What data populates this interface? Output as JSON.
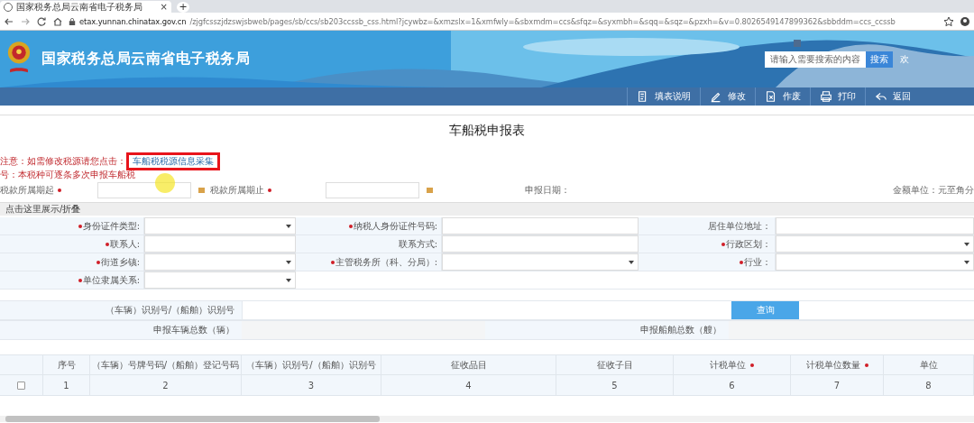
{
  "browser": {
    "tab_title": "国家税务总局云南省电子税务局",
    "tab_close": "×",
    "new_tab": "+",
    "url_host": "etax.yunnan.chinatax.gov.cn",
    "url_path": "/zjgfcsszjdzswjsbweb/pages/sb/ccs/sb203ccssb_css.html?jcywbz=&xmzslx=1&xmfwly=&sbxmdm=ccs&sfqz=&syxmbh=&sqq=&sqz=&pzxh=&v=0.8026549147899362&sbbddm=ccs_ccssb"
  },
  "header": {
    "title": "国家税务总局云南省电子税务局",
    "search": {
      "placeholder": "请输入需要搜索的内容"
    },
    "search_button": "搜索",
    "greeting": "欢"
  },
  "toolbar": [
    {
      "label": "填表说明"
    },
    {
      "label": "修改"
    },
    {
      "label": "作废"
    },
    {
      "label": "打印"
    },
    {
      "label": "返回"
    }
  ],
  "form_title": "车船税申报表",
  "notice": {
    "line1": "注意：如需修改税源请您点击：",
    "link": "车船税税源信息采集",
    "line2": "号：本税种可逐条多次申报车船税"
  },
  "period": {
    "start_label": "税款所属期起",
    "end_label": "税款所属期止",
    "date_label": "申报日期：",
    "unit": "金额单位：元至角分"
  },
  "collapse": "点击这里展示/折叠",
  "fields": [
    [
      {
        "label": "身份证件类型:",
        "required": true,
        "kind": "select"
      },
      {
        "label": "纳税人身份证件号码:",
        "required": true,
        "kind": "text"
      },
      {
        "label": "居住单位地址：",
        "required": false,
        "kind": "text"
      }
    ],
    [
      {
        "label": "联系人:",
        "required": true,
        "kind": "text"
      },
      {
        "label": "联系方式:",
        "required": false,
        "kind": "text"
      },
      {
        "label": "行政区划：",
        "required": true,
        "kind": "select"
      }
    ],
    [
      {
        "label": "街道乡镇:",
        "required": true,
        "kind": "select"
      },
      {
        "label": "主管税务所（科、分局）:",
        "required": true,
        "kind": "select"
      },
      {
        "label": "行业：",
        "required": true,
        "kind": "select"
      }
    ],
    [
      {
        "label": "单位隶属关系:",
        "required": true,
        "kind": "select"
      }
    ]
  ],
  "query": {
    "label": "（车辆）识别号/（船舶）识别号",
    "button": "查询",
    "vehicle_total": "申报车辆总数（辆）",
    "vessel_total": "申报船舶总数（艘）"
  },
  "table": {
    "columns": [
      {
        "label": "序号",
        "required": false
      },
      {
        "label": "（车辆）号牌号码/（船舶）登记号码",
        "required": false
      },
      {
        "label": "（车辆）识别号/（船舶）识别号",
        "required": false
      },
      {
        "label": "征收品目",
        "required": false
      },
      {
        "label": "征收子目",
        "required": false
      },
      {
        "label": "计税单位",
        "required": true
      },
      {
        "label": "计税单位数量",
        "required": true
      },
      {
        "label": "单位",
        "required": false
      }
    ],
    "rows": [
      {
        "checked": false,
        "cells": [
          "1",
          "2",
          "3",
          "4",
          "5",
          "6",
          "7",
          "8"
        ]
      }
    ]
  }
}
